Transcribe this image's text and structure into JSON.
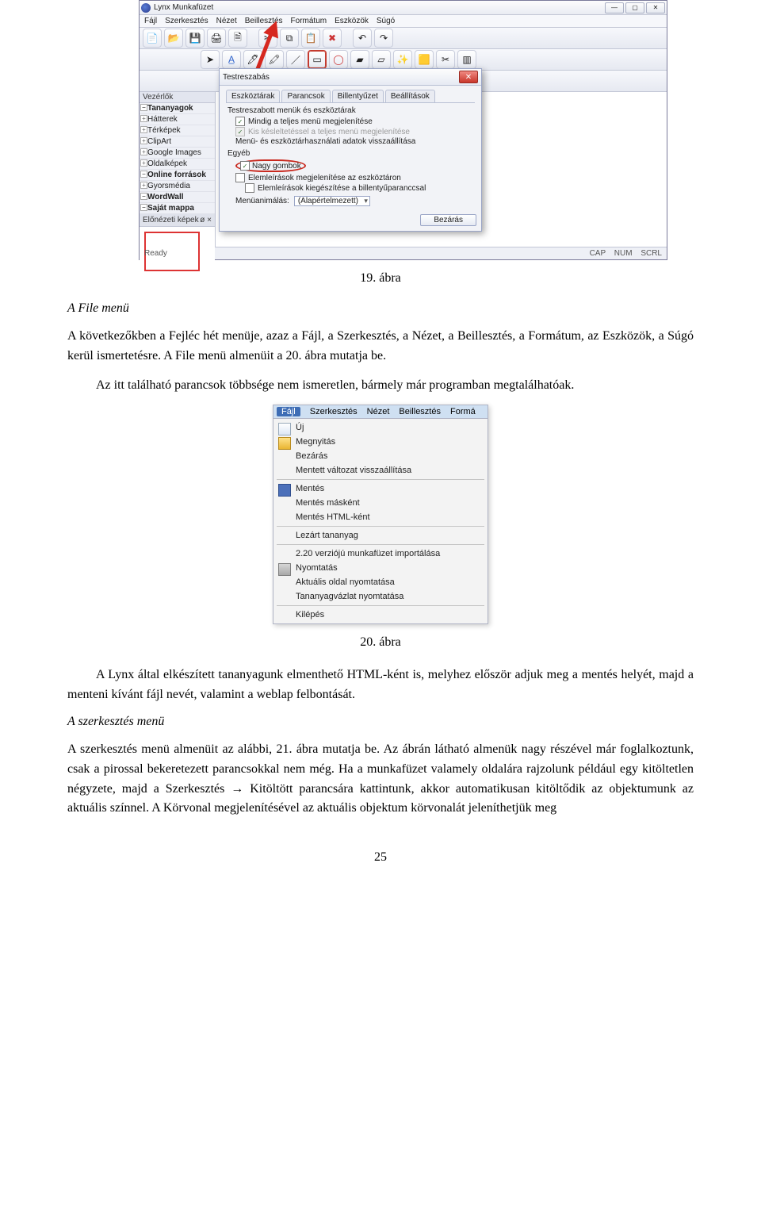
{
  "shot1": {
    "app_title": "Lynx Munkafüzet",
    "menus": [
      "Fájl",
      "Szerkesztés",
      "Nézet",
      "Beillesztés",
      "Formátum",
      "Eszközök",
      "Súgó"
    ],
    "sidebar_header": "Vezérlők",
    "sidebar_items": [
      {
        "label": "Tananyagok",
        "bold": true
      },
      {
        "label": "Hátterek",
        "bold": false
      },
      {
        "label": "Térképek",
        "bold": false
      },
      {
        "label": "ClipArt",
        "bold": false
      },
      {
        "label": "Google Images",
        "bold": false
      },
      {
        "label": "Oldalképek",
        "bold": false
      },
      {
        "label": "Online források",
        "bold": true
      },
      {
        "label": "Gyorsmédia",
        "bold": false
      },
      {
        "label": "WordWall",
        "bold": true
      },
      {
        "label": "Saját mappa",
        "bold": true
      }
    ],
    "preview_header": "Előnézeti képek",
    "preview_pin": "ø   ×",
    "statusbar_left": "Ready",
    "statusbar_right": [
      "CAP",
      "NUM",
      "SCRL"
    ],
    "dialog": {
      "title": "Testreszabás",
      "tabs": [
        "Eszköztárak",
        "Parancsok",
        "Billentyűzet",
        "Beállítások"
      ],
      "group1": "Testreszabott menük és eszköztárak",
      "opt_always": "Mindig a teljes menü megjelenítése",
      "opt_delay": "Kis késleltetéssel a teljes menü megjelenítése",
      "reset_label": "Menü- és eszköztárhasználati adatok visszaállítása",
      "group2": "Egyéb",
      "big_buttons": "Nagy gombok",
      "tooltips": "Elemleírások megjelenítése az eszköztáron",
      "shortcuts": "Elemleírások kiegészítése a billentyűparanccsal",
      "anim_label": "Menüanimálás:",
      "anim_value": "(Alapértelmezett)",
      "close": "Bezárás"
    }
  },
  "caption1": "19. ábra",
  "h1": "A File menü",
  "p1": "A következőkben a Fejléc hét menüje, azaz a Fájl, a Szerkesztés, a Nézet, a Beillesztés, a Formátum, az Eszközök, a Súgó kerül ismertetésre. A File menü almenüit a 20. ábra mutatja be.",
  "p2": "Az itt található parancsok többsége nem ismeretlen, bármely már programban megtalálhatóak.",
  "shot2": {
    "menus": [
      "Fájl",
      "Szerkesztés",
      "Nézet",
      "Beillesztés",
      "Formá"
    ],
    "groups": [
      [
        {
          "icon": "new",
          "label": "Új"
        },
        {
          "icon": "open",
          "label": "Megnyitás"
        },
        {
          "icon": "",
          "label": "Bezárás"
        },
        {
          "icon": "",
          "label": "Mentett változat visszaállítása"
        }
      ],
      [
        {
          "icon": "save",
          "label": "Mentés"
        },
        {
          "icon": "",
          "label": "Mentés másként"
        },
        {
          "icon": "",
          "label": "Mentés HTML-ként"
        }
      ],
      [
        {
          "icon": "",
          "label": "Lezárt tananyag"
        }
      ],
      [
        {
          "icon": "",
          "label": "2.20 verziójú munkafüzet importálása"
        },
        {
          "icon": "print",
          "label": "Nyomtatás"
        },
        {
          "icon": "",
          "label": "Aktuális oldal nyomtatása"
        },
        {
          "icon": "",
          "label": "Tananyagvázlat nyomtatása"
        }
      ],
      [
        {
          "icon": "",
          "label": "Kilépés"
        }
      ]
    ]
  },
  "caption2": "20. ábra",
  "p3": "A Lynx által elkészített tananyagunk elmenthető HTML-ként is, melyhez először adjuk meg a mentés helyét, majd a menteni kívánt fájl nevét, valamint a weblap felbontását.",
  "h2": "A szerkesztés menü",
  "p4": "A szerkesztés menü almenüit az alábbi, 21. ábra mutatja be. Az ábrán látható almenük nagy részével már foglalkoztunk, csak a pirossal bekeretezett parancsokkal nem még. Ha a munkafüzet valamely oldalára rajzolunk például egy kitöltetlen négyzete, majd a Szerkesztés → Kitöltött parancsára kattintunk, akkor automatikusan kitöltődik az objektumunk az aktuális színnel. A Körvonal megjelenítésével az aktuális objektum körvonalát jeleníthetjük meg",
  "page_num": "25"
}
